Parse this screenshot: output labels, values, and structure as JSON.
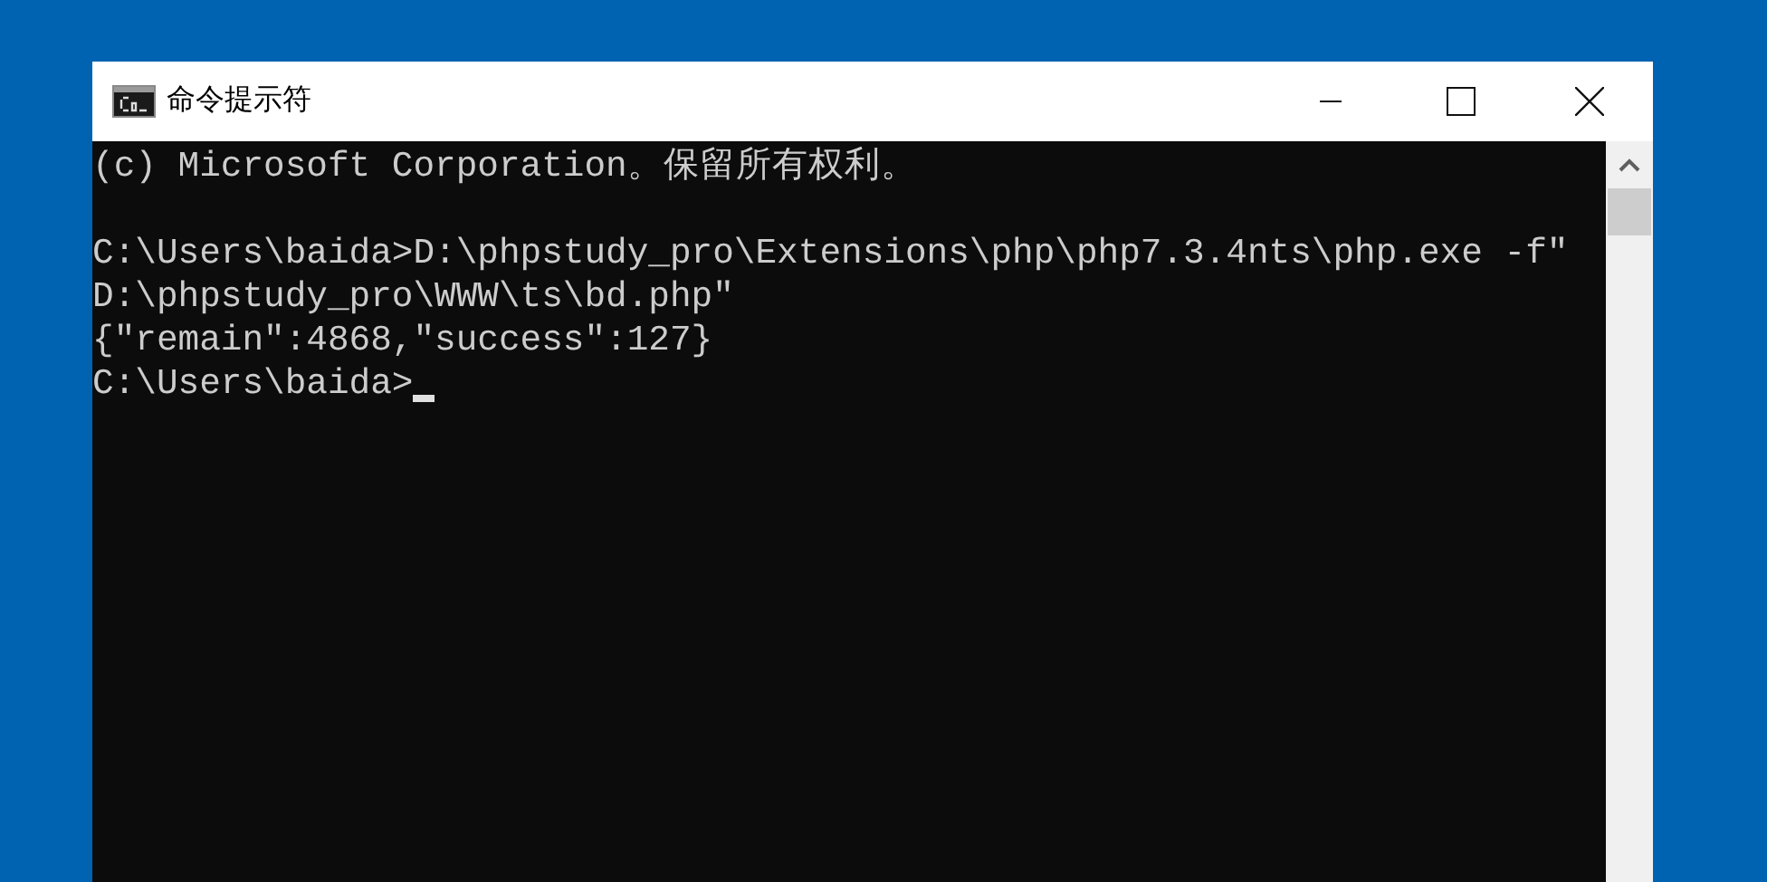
{
  "window": {
    "title": "命令提示符"
  },
  "console": {
    "lines": [
      {
        "kind": "output",
        "text": "(c) Microsoft Corporation。保留所有权利。"
      },
      {
        "kind": "blank"
      },
      {
        "kind": "output",
        "text": "C:\\Users\\baida>D:\\phpstudy_pro\\Extensions\\php\\php7.3.4nts\\php.exe -f\""
      },
      {
        "kind": "output",
        "text": "D:\\phpstudy_pro\\WWW\\ts\\bd.php\""
      },
      {
        "kind": "output",
        "text": "{\"remain\":4868,\"success\":127}"
      },
      {
        "kind": "prompt",
        "text": "C:\\Users\\baida>"
      }
    ],
    "cursor_visible": true
  }
}
